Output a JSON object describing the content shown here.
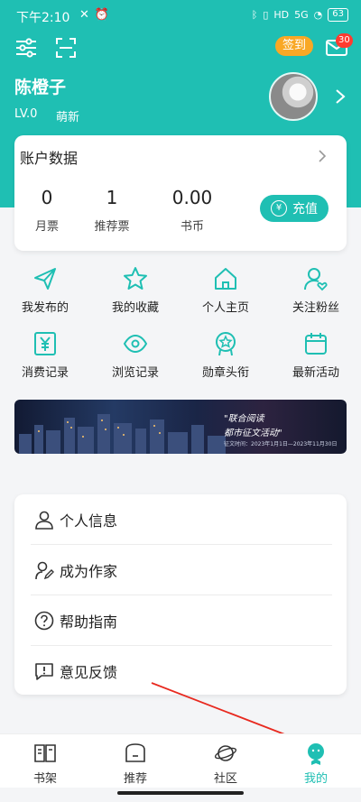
{
  "status_bar": {
    "time": "下午2:10",
    "network": "5G",
    "battery": "63"
  },
  "header": {
    "checkin_label": "签到",
    "mail_badge": "30"
  },
  "profile": {
    "name": "陈橙子",
    "level": "LV.0",
    "nickname": "萌新"
  },
  "account": {
    "title": "账户数据",
    "stats": [
      {
        "value": "0",
        "label": "月票"
      },
      {
        "value": "1",
        "label": "推荐票"
      },
      {
        "value": "0.00",
        "label": "书币"
      }
    ],
    "recharge_label": "充值",
    "recharge_icon": "¥"
  },
  "menu": [
    {
      "label": "我发布的",
      "icon": "paper-plane-icon"
    },
    {
      "label": "我的收藏",
      "icon": "star-icon"
    },
    {
      "label": "个人主页",
      "icon": "home-icon"
    },
    {
      "label": "关注粉丝",
      "icon": "user-heart-icon"
    },
    {
      "label": "消费记录",
      "icon": "yen-receipt-icon"
    },
    {
      "label": "浏览记录",
      "icon": "eye-icon"
    },
    {
      "label": "勋章头衔",
      "icon": "medal-icon"
    },
    {
      "label": "最新活动",
      "icon": "calendar-icon"
    }
  ],
  "banner": {
    "title_line1": "\"联合阅读",
    "title_line2": "都市征文活动\"",
    "date_line": "征文时间：2023年1月1日—2023年11月30日"
  },
  "list": [
    {
      "label": "个人信息",
      "icon": "user-icon"
    },
    {
      "label": "成为作家",
      "icon": "writer-icon"
    },
    {
      "label": "帮助指南",
      "icon": "help-icon"
    },
    {
      "label": "意见反馈",
      "icon": "feedback-icon"
    }
  ],
  "nav": [
    {
      "label": "书架",
      "icon": "bookshelf-icon"
    },
    {
      "label": "推荐",
      "icon": "recommend-icon"
    },
    {
      "label": "社区",
      "icon": "community-icon"
    },
    {
      "label": "我的",
      "icon": "profile-icon",
      "active": true
    }
  ],
  "colors": {
    "accent": "#1fbfb3",
    "checkin": "#f9a825",
    "badge": "#ff3b30",
    "annotation_arrow": "#e8291f"
  }
}
